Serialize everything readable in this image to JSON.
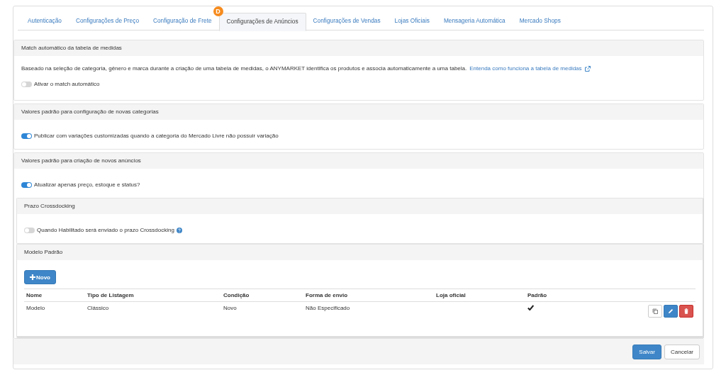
{
  "tabs": [
    {
      "label": "Autenticação",
      "selected": false
    },
    {
      "label": "Configurações de Preço",
      "selected": false
    },
    {
      "label": "Configuração de Frete",
      "selected": false
    },
    {
      "label": "Configurações de Anúncios",
      "selected": true,
      "badge": "D"
    },
    {
      "label": "Configurações de Vendas",
      "selected": false
    },
    {
      "label": "Lojas Oficiais",
      "selected": false
    },
    {
      "label": "Mensageria Automática",
      "selected": false
    },
    {
      "label": "Mercado Shops",
      "selected": false
    }
  ],
  "match_panel": {
    "title": "Match automático da tabela de medidas",
    "description": "Baseado na seleção de categoria, gênero e marca durante a criação de uma tabela de medidas, o ANYMARKET identifica os produtos e associa automaticamente a uma tabela.",
    "link": "Entenda como funciona a tabela de medidas",
    "toggle": {
      "label": "Ativar o match automático",
      "on": false
    }
  },
  "categories_panel": {
    "title": "Valores padrão para configuração de novas categorias",
    "toggle": {
      "label": "Publicar com variações customizadas quando a categoria do Mercado Livre não possuir variação",
      "on": true
    }
  },
  "listings_panel": {
    "title": "Valores padrão para criação de novos anúncios",
    "toggle": {
      "label": "Atualizar apenas preço, estoque e status?",
      "on": true
    },
    "crossdocking": {
      "title": "Prazo Crossdocking",
      "toggle": {
        "label": "Quando Habilitado será enviado o prazo Crossdocking",
        "on": false,
        "help": true
      }
    },
    "template": {
      "title": "Modelo Padrão",
      "new_button": "Novo",
      "columns": [
        "Nome",
        "Tipo de Listagem",
        "Condição",
        "Forma de envio",
        "Loja oficial",
        "Padrão"
      ],
      "rows": [
        {
          "name": "Modelo",
          "listing_type": "Clássico",
          "condition": "Novo",
          "shipping": "Não Especificado",
          "default": true
        }
      ]
    }
  },
  "buttons": [
    "Salvar",
    "Cancelar"
  ]
}
